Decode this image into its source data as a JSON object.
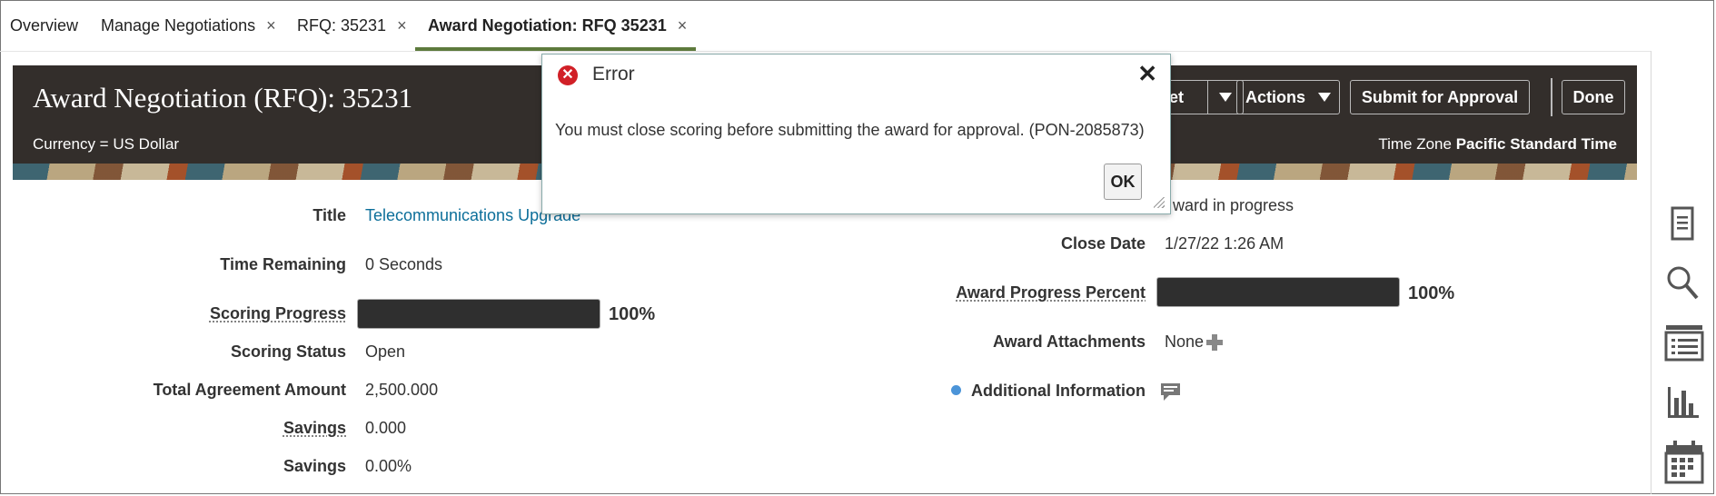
{
  "tabs": [
    {
      "label": "Overview",
      "closable": false
    },
    {
      "label": "Manage Negotiations",
      "closable": true
    },
    {
      "label": "RFQ: 35231",
      "closable": true
    },
    {
      "label": "Award Negotiation: RFQ 35231",
      "closable": true,
      "active": true
    }
  ],
  "close_glyph": "×",
  "header": {
    "title": "Award Negotiation (RFQ): 35231",
    "currency": "Currency = US Dollar",
    "timezone_prefix": "Time Zone",
    "timezone_value": "Pacific Standard Time",
    "partial_button_label": "et",
    "actions_label": "Actions",
    "submit_label": "Submit for Approval",
    "done_label": "Done"
  },
  "left_fields": {
    "title_label": "Title",
    "title_value": "Telecommunications Upgrade",
    "time_remaining_label": "Time Remaining",
    "time_remaining_value": "0 Seconds",
    "scoring_progress_label": "Scoring Progress",
    "scoring_progress_percent": "100%",
    "scoring_progress_fraction": 1.0,
    "scoring_status_label": "Scoring Status",
    "scoring_status_value": "Open",
    "total_agreement_label": "Total Agreement Amount",
    "total_agreement_value": "2,500.000",
    "savings_label": "Savings",
    "savings_value": "0.000",
    "savings_pct_label": "Savings",
    "savings_pct_value": "0.00%"
  },
  "right_fields": {
    "status_value_partial": "ward in progress",
    "close_date_label": "Close Date",
    "close_date_value": "1/27/22 1:26 AM",
    "award_progress_label": "Award Progress Percent",
    "award_progress_percent": "100%",
    "award_progress_fraction": 1.0,
    "award_attachments_label": "Award Attachments",
    "award_attachments_value": "None",
    "additional_info_label": "Additional Information"
  },
  "dialog": {
    "title": "Error",
    "message": "You must close scoring before submitting the award for approval. (PON-2085873)",
    "ok_label": "OK",
    "close_glyph": "✕"
  },
  "side_rail": [
    "document-icon",
    "search-icon",
    "list-icon",
    "bar-chart-icon",
    "calendar-icon"
  ]
}
